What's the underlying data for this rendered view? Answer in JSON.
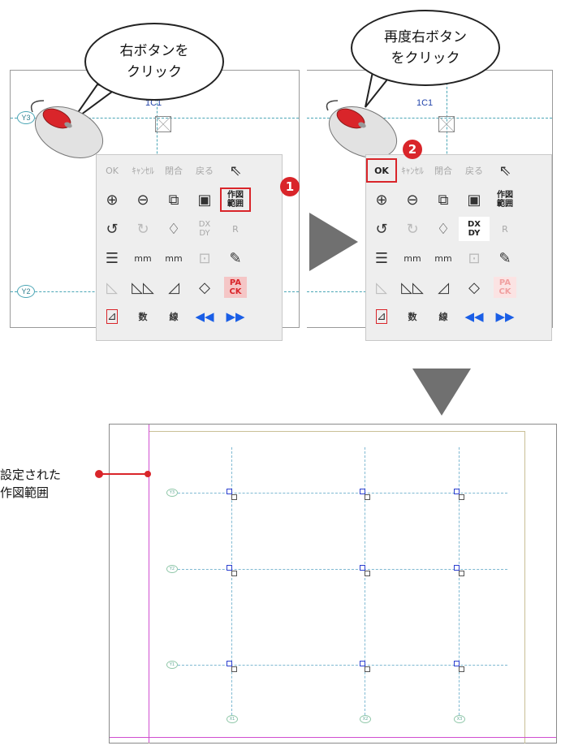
{
  "bubbles": {
    "left_line1": "右ボタンを",
    "left_line2": "クリック",
    "right_line1": "再度右ボタン",
    "right_line2": "をクリック"
  },
  "drawing": {
    "axis_y3": "Y3",
    "axis_y2": "Y2",
    "col_label_left": "1C1",
    "col_label_right": "1C1"
  },
  "toolbar": {
    "ok": "OK",
    "cancel": "ｷｬﾝｾﾙ",
    "close_loop": "閉合",
    "back": "戻る",
    "range_line1": "作図",
    "range_line2": "範囲",
    "dx": "DX",
    "dy": "DY",
    "r": "R",
    "mm": "mm",
    "pack_line1": "PA",
    "pack_line2": "CK",
    "num": "数",
    "line": "線"
  },
  "steps": {
    "step1": "1",
    "step2": "2"
  },
  "callout": {
    "line1": "設定された",
    "line2": "作図範囲"
  },
  "mini_axes": {
    "y3": "Y3",
    "y2": "Y2",
    "y1": "Y1",
    "x1": "X1",
    "x2": "X2",
    "x3": "X3"
  },
  "colors": {
    "accent_red": "#d9252a",
    "grid_line": "#4aa5b5",
    "arrow_gray": "#707070",
    "range_frame": "#c9bf96",
    "blue_icon": "#1a5ee6"
  }
}
